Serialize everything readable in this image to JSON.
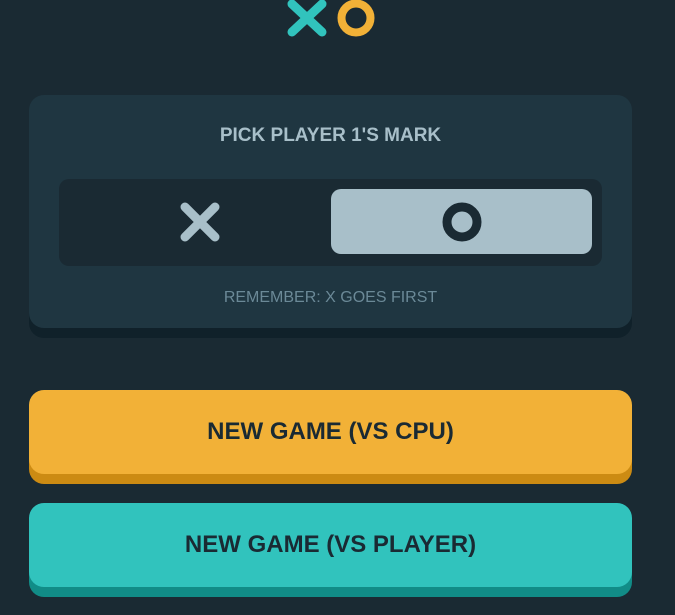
{
  "logo": {
    "icons": [
      "x-mark-icon",
      "o-mark-icon"
    ]
  },
  "pick_card": {
    "title": "PICK PLAYER 1'S MARK",
    "options": [
      {
        "mark": "X",
        "icon": "x-mark-icon",
        "selected": false
      },
      {
        "mark": "O",
        "icon": "o-mark-icon",
        "selected": true
      }
    ],
    "reminder": "REMEMBER: X GOES FIRST"
  },
  "buttons": {
    "vs_cpu": "NEW GAME (VS CPU)",
    "vs_player": "NEW GAME (VS PLAYER)"
  },
  "colors": {
    "background": "#1a2a33",
    "card": "#1f3641",
    "silver": "#a8bfc9",
    "yellow": "#f2b137",
    "teal": "#31c3bd"
  }
}
